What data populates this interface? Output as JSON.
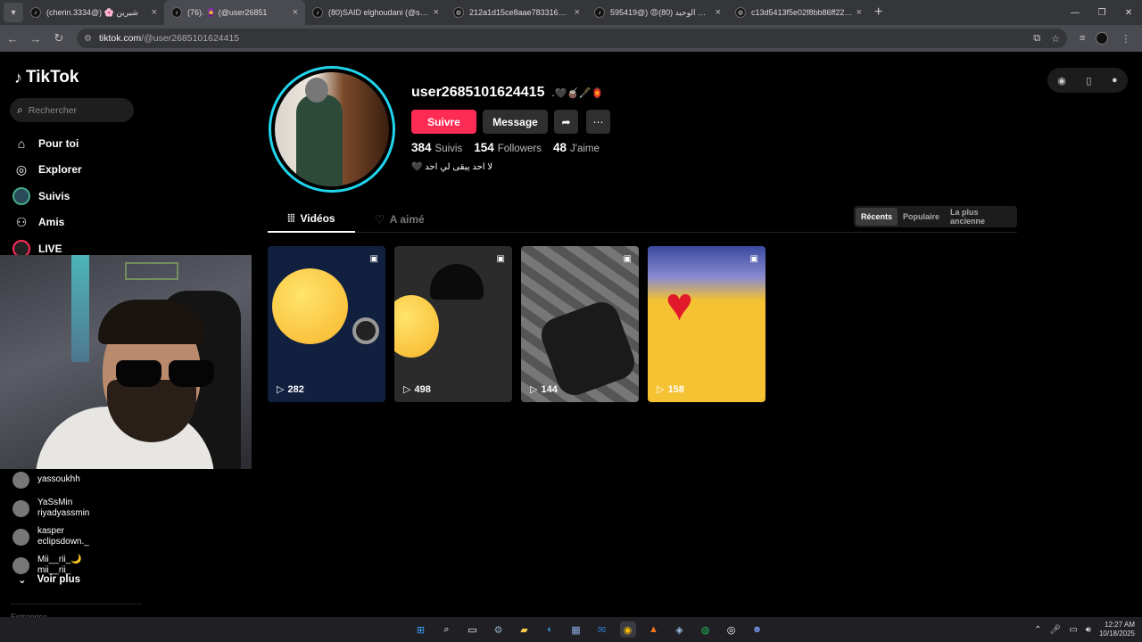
{
  "browser": {
    "tabs": [
      {
        "title": "(cherin.3334@) 🌸 شيرين",
        "extra": "🔊"
      },
      {
        "title": "(76). 🧕 (@user26851",
        "active": true
      },
      {
        "title": "(80)SAID elghoudani (@saidelg"
      },
      {
        "title": "212a1d15ce8aae783316a8149"
      },
      {
        "title": "595419@) 😡سرعني الوحيد (80)"
      },
      {
        "title": "c13d5413f5e02f8bb86ff2209d"
      }
    ],
    "url_host": "tiktok.com",
    "url_path": "/@user2685101624415"
  },
  "sidebar": {
    "logo": "TikTok",
    "search_placeholder": "Rechercher",
    "nav": [
      {
        "label": "Pour toi",
        "icon": "home-icon"
      },
      {
        "label": "Explorer",
        "icon": "compass-icon"
      },
      {
        "label": "Suivis",
        "icon": "avatar-icon"
      },
      {
        "label": "Amis",
        "icon": "friends-icon"
      },
      {
        "label": "LIVE",
        "icon": "live-icon"
      }
    ],
    "following": [
      {
        "name": "yassoukhh",
        "handle": ""
      },
      {
        "name": "YaSsMin",
        "handle": "riyadyassmin"
      },
      {
        "name": "kasper",
        "handle": "eclipsdown._"
      },
      {
        "name": "Mii__rii_🌙",
        "handle": "mii__rii_"
      }
    ],
    "see_more": "Voir plus",
    "footer": "Entreprise"
  },
  "profile": {
    "username": "user2685101624415",
    "emojis": ".🖤🧉🖋️🏮",
    "follow_label": "Suivre",
    "message_label": "Message",
    "stats": {
      "following_count": "384",
      "following_label": "Suivis",
      "followers_count": "154",
      "followers_label": "Followers",
      "likes_count": "48",
      "likes_label": "J'aime"
    },
    "bio": "لا احد يبقى لي احد 🖤"
  },
  "tabs": {
    "videos": "Vidéos",
    "liked": "A aimé",
    "sort": [
      "Récents",
      "Populaire",
      "La plus ancienne"
    ]
  },
  "videos": [
    {
      "views": "282",
      "bg": "#12203f"
    },
    {
      "views": "498",
      "bg": "#2b2b2b"
    },
    {
      "views": "144",
      "bg": "#6a6a6a"
    },
    {
      "views": "158",
      "bg": "#f4c232"
    }
  ],
  "taskbar": {
    "time": "12:27 AM",
    "date": "10/18/2025"
  }
}
